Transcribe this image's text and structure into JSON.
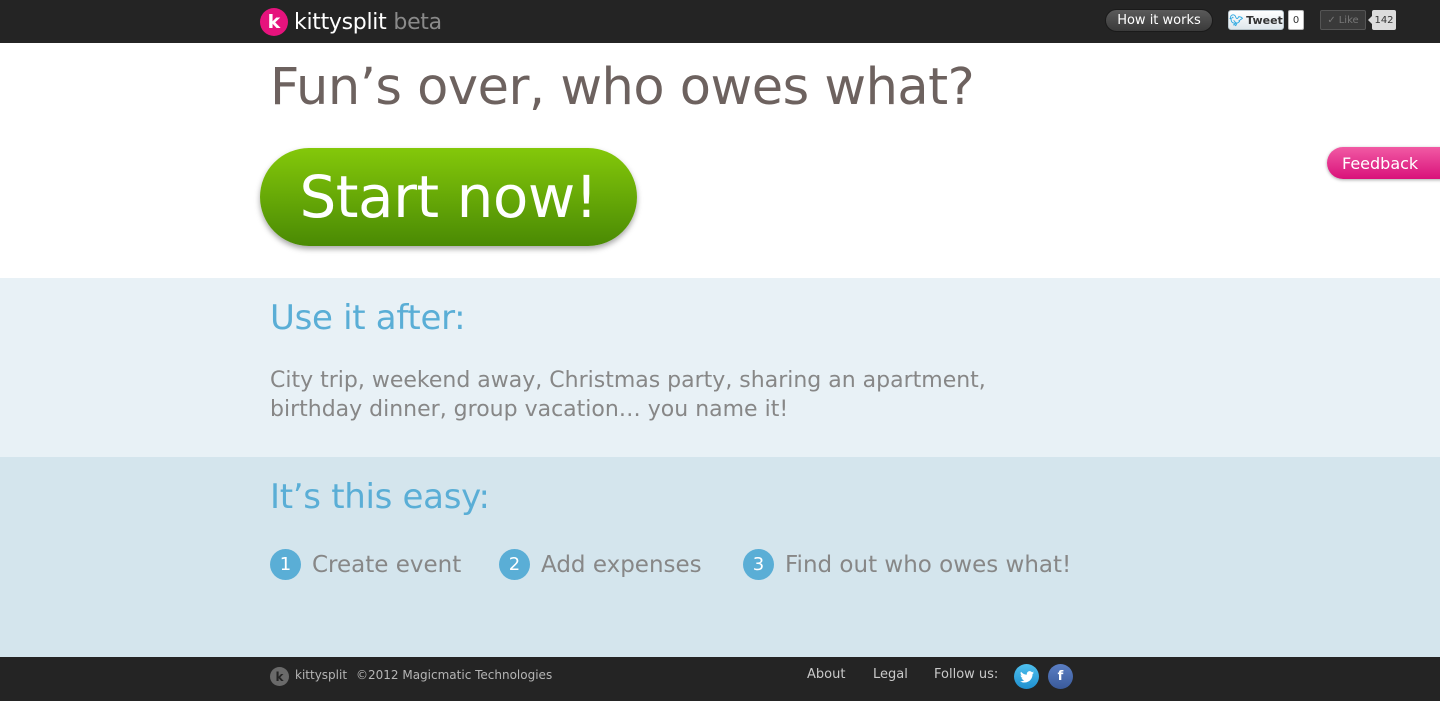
{
  "header": {
    "logo_letter": "k",
    "brand_name": "kittysplit",
    "brand_tag": "beta",
    "how_it_works_label": "How it works",
    "tweet_label": "Tweet",
    "tweet_count": "0",
    "like_label": "Like",
    "like_count": "142"
  },
  "hero": {
    "headline": "Fun’s over, who owes what?",
    "start_label": "Start now!"
  },
  "feedback_label": "Feedback",
  "use_after": {
    "title": "Use it after:",
    "text": "City trip, weekend away, Christmas party, sharing an apartment, birthday dinner, group vacation… you name it!"
  },
  "easy": {
    "title": "It’s this easy:",
    "steps": [
      {
        "num": "1",
        "label": "Create event"
      },
      {
        "num": "2",
        "label": "Add expenses"
      },
      {
        "num": "3",
        "label": "Find out who owes what!"
      }
    ]
  },
  "footer": {
    "logo_letter": "k",
    "brand_name": "kittysplit",
    "copyright": "©2012 Magicmatic Technologies",
    "about_label": "About",
    "legal_label": "Legal",
    "follow_label": "Follow us:",
    "twitter_icon": "twitter-icon",
    "facebook_icon": "facebook-icon"
  },
  "colors": {
    "brand_pink": "#e6137d",
    "start_green": "#6fb808",
    "accent_blue": "#5aaed6",
    "dark_bar": "#242424"
  }
}
